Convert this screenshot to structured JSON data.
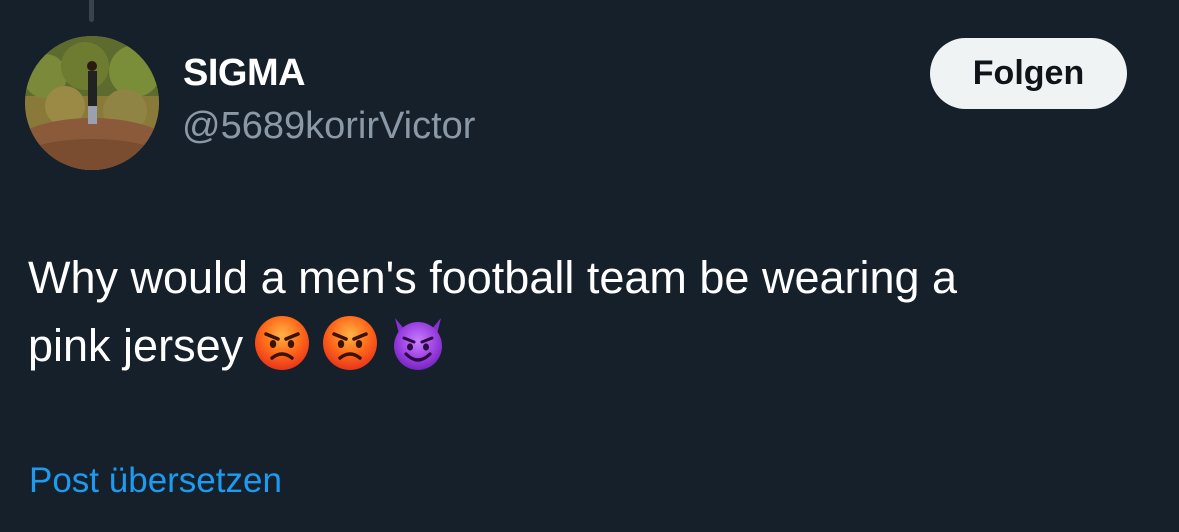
{
  "post": {
    "author": {
      "display_name": "SIGMA",
      "handle": "@5689korirVictor",
      "avatar_icon": "profile-photo"
    },
    "follow_label": "Folgen",
    "text_lines": [
      "Why would a men's football team be wearing a",
      "pink jersey"
    ],
    "emojis": [
      "angry-face-icon",
      "angry-face-icon",
      "smiling-devil-icon"
    ],
    "translate_label": "Post übersetzen"
  },
  "colors": {
    "background": "#15202b",
    "secondary_text": "#8b98a5",
    "link": "#1d9bf0",
    "follow_button_bg": "#eff3f4"
  }
}
